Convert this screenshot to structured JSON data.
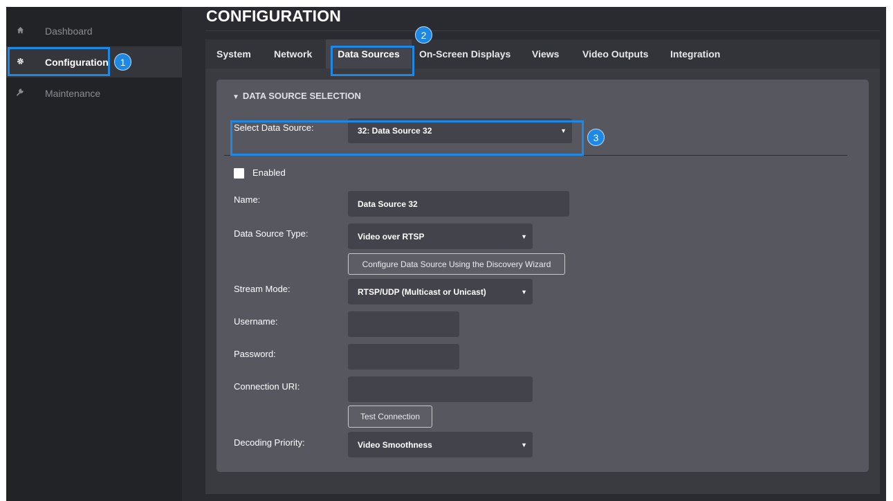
{
  "sidebar": {
    "items": [
      {
        "label": "Dashboard",
        "icon": "home-icon"
      },
      {
        "label": "Configuration",
        "icon": "gear-icon"
      },
      {
        "label": "Maintenance",
        "icon": "wrench-icon"
      }
    ]
  },
  "header": {
    "title": "CONFIGURATION"
  },
  "tabs": [
    {
      "label": "System"
    },
    {
      "label": "Network"
    },
    {
      "label": "Data Sources"
    },
    {
      "label": "On-Screen Displays"
    },
    {
      "label": "Views"
    },
    {
      "label": "Video Outputs"
    },
    {
      "label": "Integration"
    }
  ],
  "section": {
    "title": "DATA SOURCE SELECTION"
  },
  "form": {
    "select_source_label": "Select Data Source:",
    "select_source_value": "32: Data Source 32",
    "enabled_label": "Enabled",
    "name_label": "Name:",
    "name_value": "Data Source 32",
    "type_label": "Data Source Type:",
    "type_value": "Video over RTSP",
    "wizard_button": "Configure Data Source Using the Discovery Wizard",
    "stream_mode_label": "Stream Mode:",
    "stream_mode_value": "RTSP/UDP (Multicast or Unicast)",
    "username_label": "Username:",
    "username_value": "",
    "password_label": "Password:",
    "password_value": "",
    "uri_label": "Connection URI:",
    "uri_value": "",
    "test_button": "Test Connection",
    "decoding_label": "Decoding Priority:",
    "decoding_value": "Video Smoothness"
  },
  "annotations": {
    "badge1": "1",
    "badge2": "2",
    "badge3": "3"
  },
  "colors": {
    "accent": "#1e88e5",
    "panel": "#56575f",
    "sidebar": "#222327"
  }
}
